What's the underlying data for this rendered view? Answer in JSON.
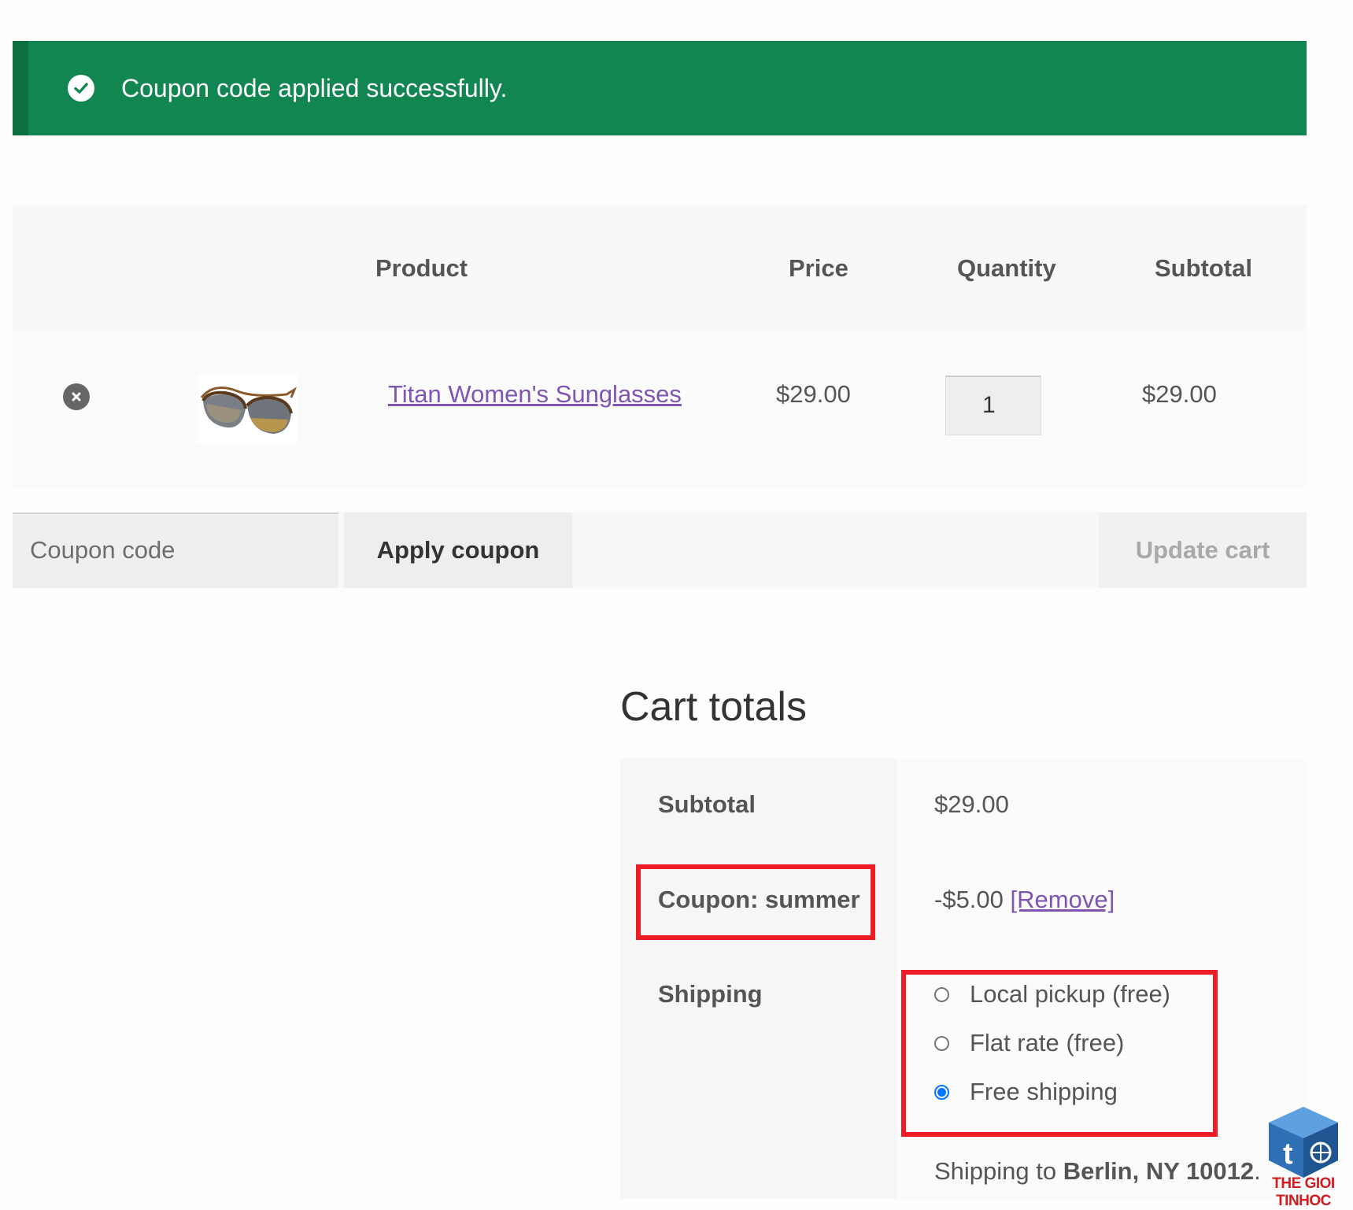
{
  "notice": {
    "message": "Coupon code applied successfully.",
    "icon": "check-circle-icon",
    "color": "#118650"
  },
  "cart": {
    "headers": {
      "product": "Product",
      "price": "Price",
      "quantity": "Quantity",
      "subtotal": "Subtotal"
    },
    "items": [
      {
        "name": "Titan Women's Sunglasses",
        "price": "$29.00",
        "quantity": "1",
        "subtotal": "$29.00"
      }
    ]
  },
  "actions": {
    "coupon_placeholder": "Coupon code",
    "apply_label": "Apply coupon",
    "update_label": "Update cart"
  },
  "totals": {
    "title": "Cart totals",
    "subtotal_label": "Subtotal",
    "subtotal_value": "$29.00",
    "coupon_label": "Coupon: summer",
    "coupon_value": "-$5.00",
    "coupon_remove": "[Remove]",
    "shipping_label": "Shipping",
    "shipping_options": [
      {
        "label": "Local pickup (free)",
        "checked": false
      },
      {
        "label": "Flat rate (free)",
        "checked": false
      },
      {
        "label": "Free shipping",
        "checked": true
      }
    ],
    "shipping_to_prefix": "Shipping to",
    "shipping_to_address": "Berlin, NY 10012",
    "shipping_to_suffix": "."
  },
  "colors": {
    "accent_link": "#7f54b3",
    "highlight": "#ee1c24",
    "radio_checked": "#0075ff"
  },
  "watermark": {
    "text": "THE GIOI TINHOC"
  }
}
